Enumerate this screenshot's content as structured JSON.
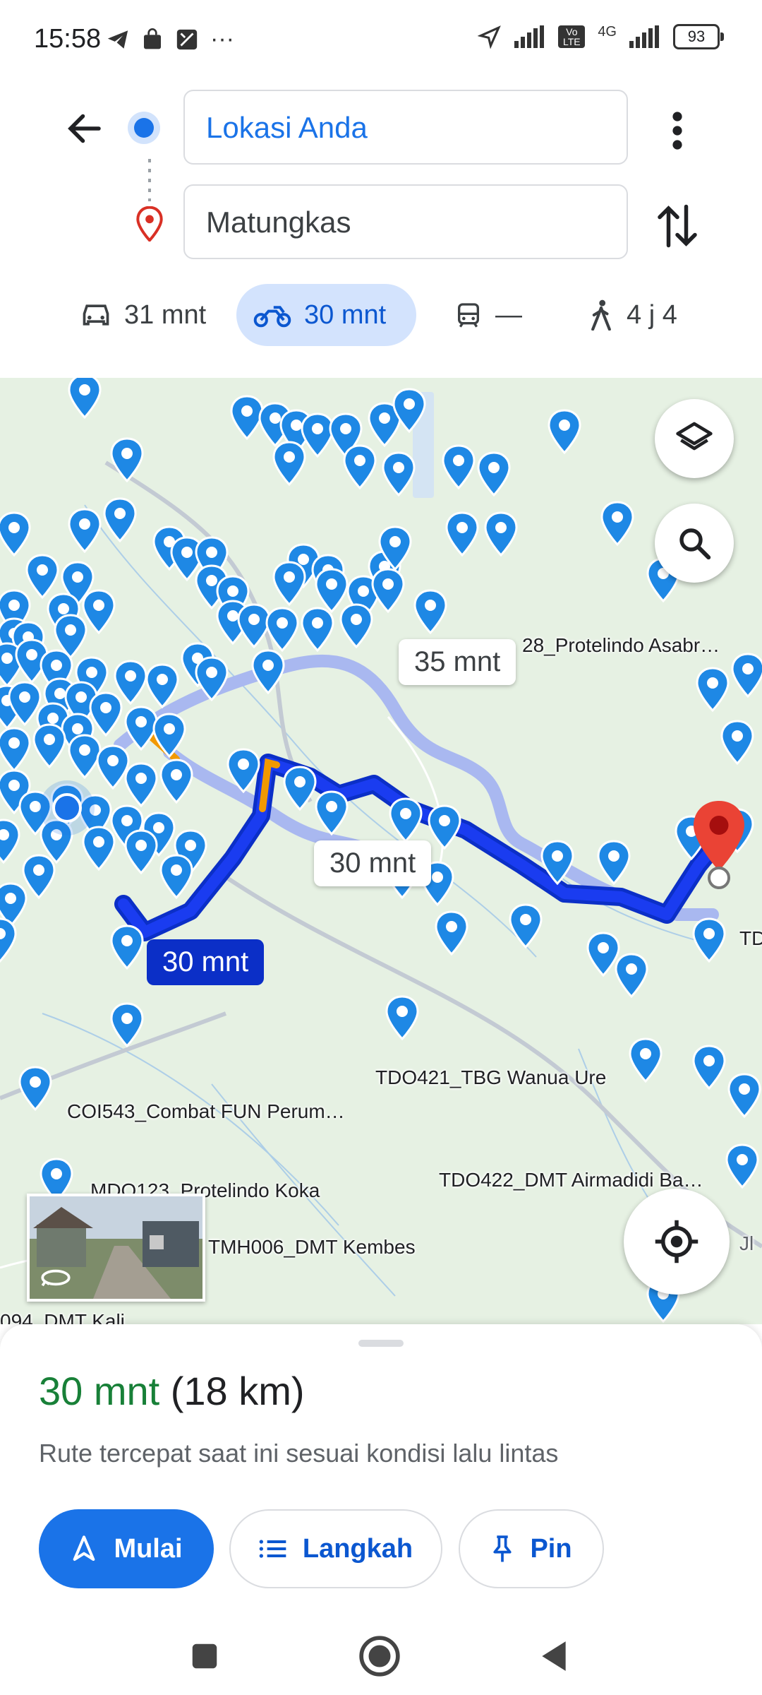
{
  "status_bar": {
    "time": "15:58",
    "network": "4G",
    "volte": "Vo LTE",
    "battery": "93",
    "more": "···"
  },
  "directions": {
    "origin": "Lokasi Anda",
    "destination": "Matungkas",
    "modes": [
      {
        "icon": "car-icon",
        "label": "31 mnt"
      },
      {
        "icon": "motorcycle-icon",
        "label": "30 mnt",
        "selected": true
      },
      {
        "icon": "transit-icon",
        "label": "—"
      },
      {
        "icon": "walk-icon",
        "label": "4 j 4"
      }
    ]
  },
  "map": {
    "route_times": {
      "selected": "30 mnt",
      "alt1": "35 mnt",
      "alt2": "30 mnt"
    },
    "labels": [
      "28_Protelindo Asabr…",
      "TD",
      "TDO421_TBG Wanua Ure",
      "COI543_Combat FUN Perum…",
      "MDO123_Protelindo Koka",
      "TDO422_DMT Airmadidi Ba…",
      "TMH006_DMT Kembes",
      "094_DMT Kali",
      "Jl"
    ]
  },
  "route_summary": {
    "time": "30 mnt",
    "distance": "(18 km)",
    "description": "Rute tercepat saat ini sesuai kondisi lalu lintas"
  },
  "actions": {
    "start": "Mulai",
    "steps": "Langkah",
    "pin": "Pin"
  },
  "colors": {
    "route": "#1a3cf0",
    "route_alt": "#a9b8f0",
    "accent": "#1a73e8",
    "pin": "#1e88e5",
    "dest_pin": "#ea4335",
    "time_green": "#188038"
  }
}
